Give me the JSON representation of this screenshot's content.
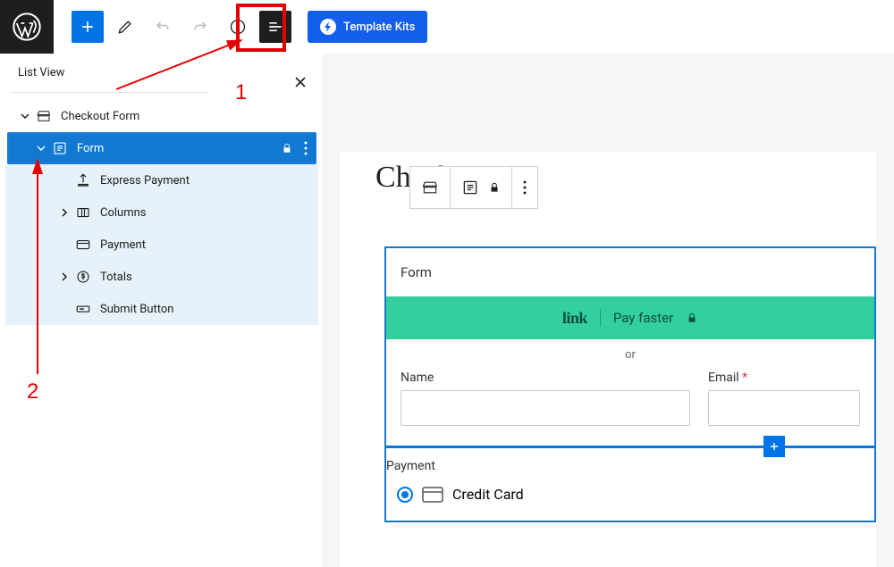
{
  "toolbar": {
    "template_kits_label": "Template Kits"
  },
  "list_view": {
    "title": "List View",
    "root": "Checkout Form",
    "selected": "Form",
    "children": [
      "Express Payment",
      "Columns",
      "Payment",
      "Totals",
      "Submit Button"
    ]
  },
  "canvas": {
    "page_title": "Checkout",
    "form_header": "Form",
    "link_brand": "link",
    "link_text": "Pay faster",
    "or_text": "or",
    "name_label": "Name",
    "email_label": "Email",
    "required_mark": "*",
    "payment_label": "Payment",
    "payment_option": "Credit Card"
  },
  "annotations": {
    "num1": "1",
    "num2": "2"
  }
}
